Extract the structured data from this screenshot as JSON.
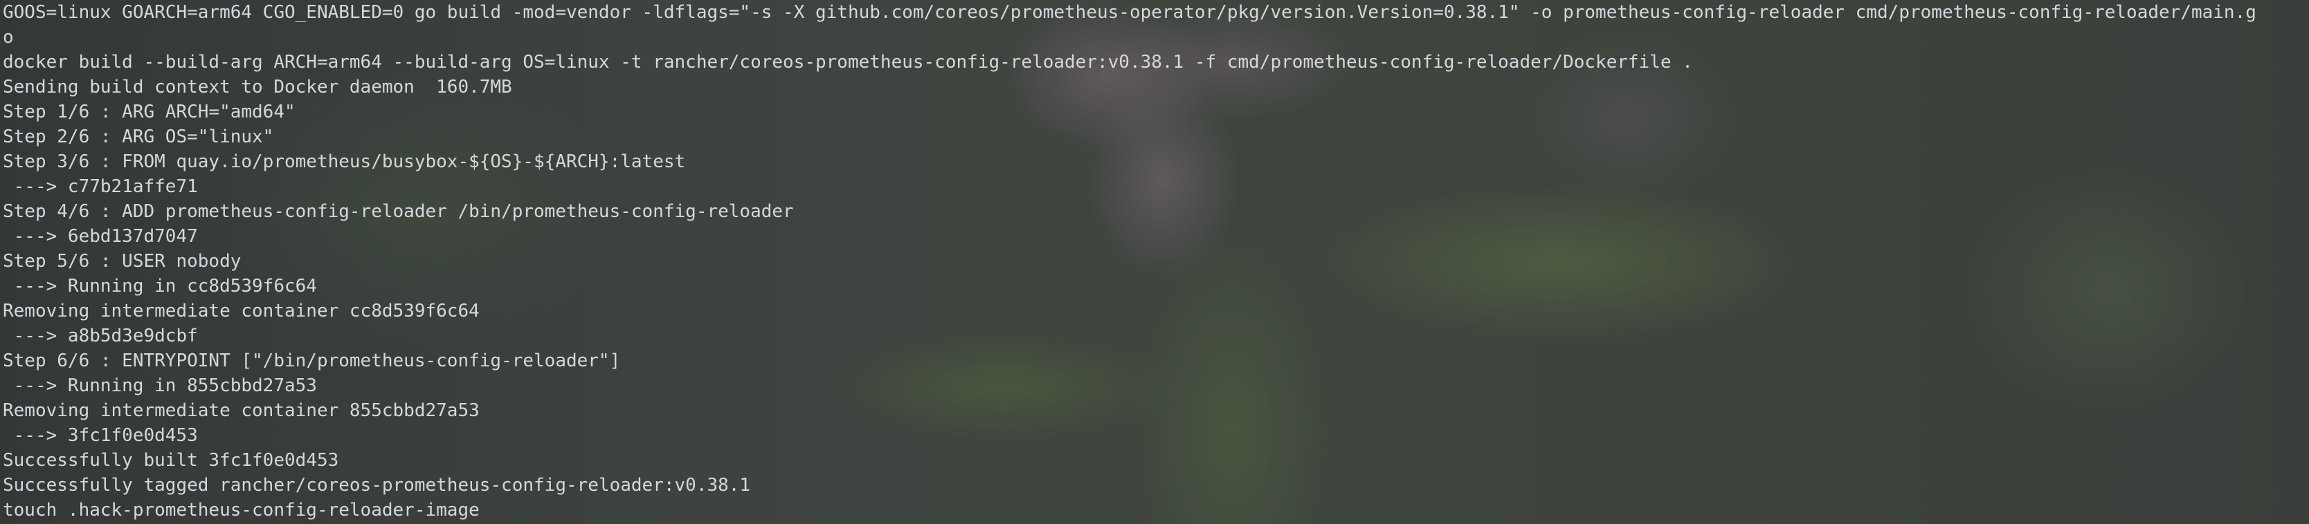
{
  "terminal": {
    "lines": [
      "GOOS=linux GOARCH=arm64 CGO_ENABLED=0 go build -mod=vendor -ldflags=\"-s -X github.com/coreos/prometheus-operator/pkg/version.Version=0.38.1\" -o prometheus-config-reloader cmd/prometheus-config-reloader/main.g",
      "o",
      "docker build --build-arg ARCH=arm64 --build-arg OS=linux -t rancher/coreos-prometheus-config-reloader:v0.38.1 -f cmd/prometheus-config-reloader/Dockerfile .",
      "Sending build context to Docker daemon  160.7MB",
      "Step 1/6 : ARG ARCH=\"amd64\"",
      "Step 2/6 : ARG OS=\"linux\"",
      "Step 3/6 : FROM quay.io/prometheus/busybox-${OS}-${ARCH}:latest",
      " ---> c77b21affe71",
      "Step 4/6 : ADD prometheus-config-reloader /bin/prometheus-config-reloader",
      " ---> 6ebd137d7047",
      "Step 5/6 : USER nobody",
      " ---> Running in cc8d539f6c64",
      "Removing intermediate container cc8d539f6c64",
      " ---> a8b5d3e9dcbf",
      "Step 6/6 : ENTRYPOINT [\"/bin/prometheus-config-reloader\"]",
      " ---> Running in 855cbbd27a53",
      "Removing intermediate container 855cbbd27a53",
      " ---> 3fc1f0e0d453",
      "Successfully built 3fc1f0e0d453",
      "Successfully tagged rancher/coreos-prometheus-config-reloader:v0.38.1",
      "touch .hack-prometheus-config-reloader-image"
    ]
  }
}
